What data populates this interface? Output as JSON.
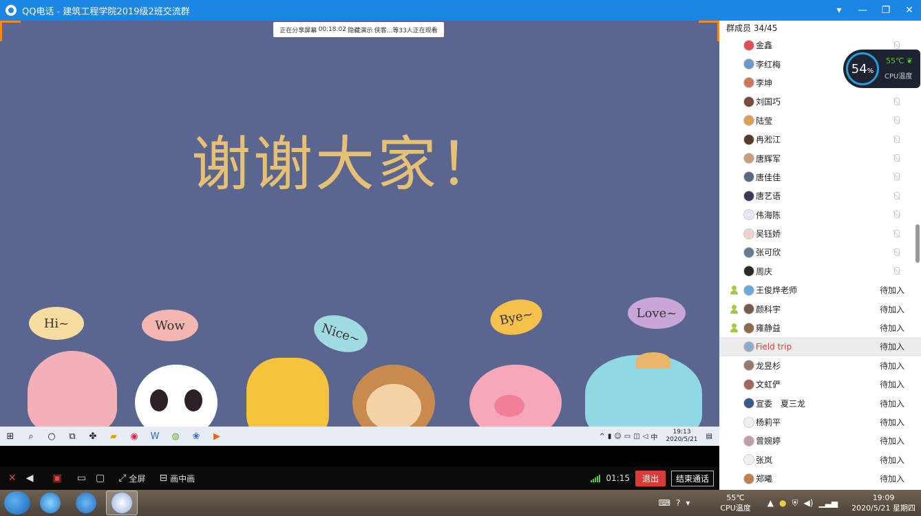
{
  "window": {
    "title": "QQ电话 - 建筑工程学院2019级2班交流群",
    "controls": [
      "▾",
      "—",
      "❐",
      "✕"
    ]
  },
  "share": {
    "bar": {
      "status": "正在分享屏幕",
      "duration": "00:18:02",
      "hint": "隐藏演示",
      "viewers": "侠客...等33人正在观看"
    },
    "headline": "谢谢大家！",
    "bubbles": [
      "Hi~",
      "Wow",
      "Nice~",
      "Bye~",
      "Love~"
    ]
  },
  "inner_taskbar": {
    "ime": "中",
    "time": "19:13",
    "date": "2020/5/21"
  },
  "controls": {
    "fullscreen": "全屏",
    "pip": "画中画",
    "elapsed": "01:15",
    "exit": "退出",
    "end_call": "结束通话"
  },
  "members": {
    "header": "群成员 34/45",
    "list": [
      {
        "name": "金鑫",
        "status": "muted",
        "color": "#e05050"
      },
      {
        "name": "李红梅",
        "status": "muted",
        "color": "#6a9ac8"
      },
      {
        "name": "李坤",
        "status": "muted",
        "color": "#c87a5a"
      },
      {
        "name": "刘国巧",
        "status": "muted",
        "color": "#7a4a3a"
      },
      {
        "name": "陆莹",
        "status": "muted",
        "color": "#d8a050"
      },
      {
        "name": "冉淞江",
        "status": "muted",
        "color": "#5a3a2a"
      },
      {
        "name": "唐辉军",
        "status": "muted",
        "color": "#c0a080"
      },
      {
        "name": "唐佳佳",
        "status": "muted",
        "color": "#5a6a7a"
      },
      {
        "name": "唐艺语",
        "status": "muted",
        "color": "#3a3a5a"
      },
      {
        "name": "伟海陈",
        "status": "muted",
        "color": "#e8e8f0"
      },
      {
        "name": "吴钰娇",
        "status": "muted",
        "color": "#f0d0d0"
      },
      {
        "name": "张可欣",
        "status": "muted",
        "color": "#6a7a8a"
      },
      {
        "name": "周庆",
        "status": "muted",
        "color": "#2a2a2a"
      },
      {
        "name": "王俊烨老师",
        "status": "待加入",
        "color": "#6aaad8",
        "invited": true
      },
      {
        "name": "颜科宇",
        "status": "待加入",
        "color": "#7a5a4a",
        "invited": true
      },
      {
        "name": "雍静益",
        "status": "待加入",
        "color": "#8a6a4a",
        "invited": true
      },
      {
        "name": "Field trip",
        "status": "待加入",
        "color": "#8aaac8",
        "highlight": true
      },
      {
        "name": "龙昱杉",
        "status": "待加入",
        "color": "#9a7a6a"
      },
      {
        "name": "文虹俨",
        "status": "待加入",
        "color": "#a06a5a"
      },
      {
        "name": "宣委　夏三龙",
        "status": "待加入",
        "color": "#3a5a8a"
      },
      {
        "name": "杨莉平",
        "status": "待加入",
        "color": "#f0f0f0"
      },
      {
        "name": "曾婉婷",
        "status": "待加入",
        "color": "#c0a0a0"
      },
      {
        "name": "张岚",
        "status": "待加入",
        "color": "#f0f0f0"
      },
      {
        "name": "郑曦",
        "status": "待加入",
        "color": "#c08050"
      }
    ]
  },
  "cpu_widget": {
    "usage": "54",
    "usage_unit": "%",
    "temp": "55℃",
    "label": "CPU温度"
  },
  "taskbar": {
    "temp": "55℃",
    "temp_label": "CPU温度",
    "time": "19:09",
    "date": "2020/5/21 星期四"
  }
}
